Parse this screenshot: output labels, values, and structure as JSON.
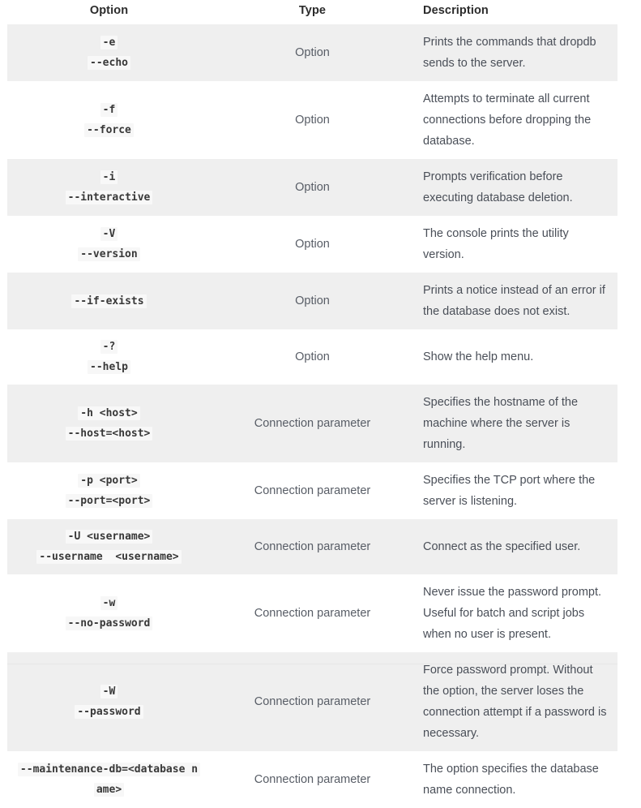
{
  "table": {
    "headers": {
      "option": "Option",
      "type": "Type",
      "description": "Description"
    },
    "types": {
      "option": "Option",
      "connection": "Connection parameter"
    },
    "rows": [
      {
        "short": "-e",
        "long": "--echo",
        "type": "Option",
        "description": "Prints the commands that dropdb sends to the server."
      },
      {
        "short": "-f",
        "long": "--force",
        "type": "Option",
        "description": "Attempts to terminate all current connections before dropping the database."
      },
      {
        "short": "-i",
        "long": "--interactive",
        "type": "Option",
        "description": "Prompts verification before executing database deletion."
      },
      {
        "short": "-V",
        "long": "--version",
        "type": "Option",
        "description": "The console prints the utility version."
      },
      {
        "short": "",
        "long": "--if-exists",
        "type": "Option",
        "description": "Prints a notice instead of an error if the database does not exist."
      },
      {
        "short": "-?",
        "long": "--help",
        "type": "Option",
        "description": "Show the help menu."
      },
      {
        "short": "-h <host>",
        "long": "--host=<host>",
        "type": "Connection parameter",
        "description": "Specifies the hostname of the machine where the server is running."
      },
      {
        "short": "-p <port>",
        "long": "--port=<port>",
        "type": "Connection parameter",
        "description": "Specifies the TCP port where the server is listening."
      },
      {
        "short": "-U <username>",
        "long": "--username  <username>",
        "type": "Connection parameter",
        "description": "Connect as the specified user."
      },
      {
        "short": "-w",
        "long": "--no-password",
        "type": "Connection parameter",
        "description": "Never issue the password prompt. Useful for batch and script jobs when no user is present."
      },
      {
        "short": "-W",
        "long": "--password",
        "type": "Connection parameter",
        "description": "Force password prompt. Without the option, the server loses the connection attempt if a password is necessary."
      },
      {
        "short": "--maintenance-db=<database n",
        "long": "ame>",
        "type": "Connection parameter",
        "description": "The option specifies the database name connection."
      }
    ]
  },
  "colors": {
    "row_shaded": "#efefef",
    "row_plain": "#ffffff",
    "header_text": "#2b2b2b",
    "body_text": "#4a4f58",
    "code_text": "#383838",
    "code_background": "#f8f8f8",
    "rule": "#e7e7e7"
  }
}
